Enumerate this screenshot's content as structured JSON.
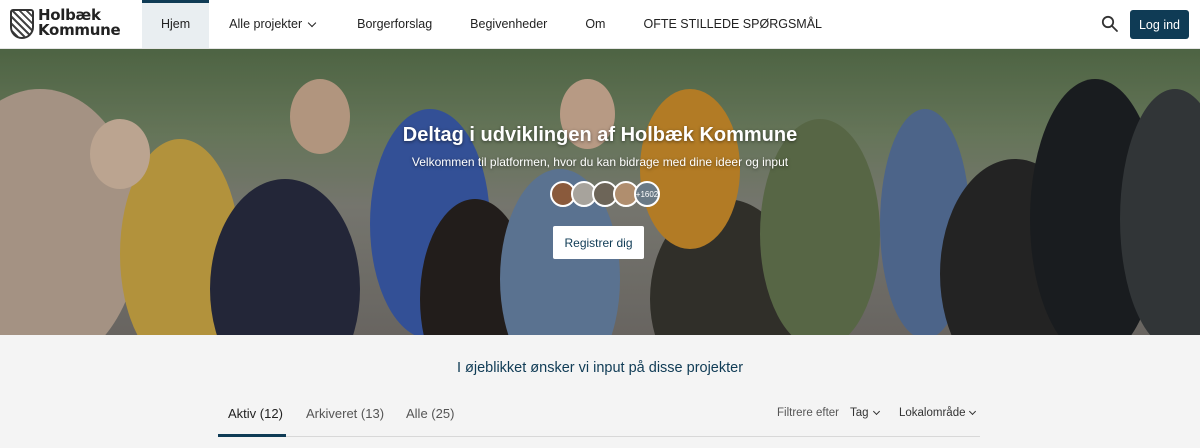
{
  "header": {
    "logo_line1": "Holbæk",
    "logo_line2": "Kommune",
    "nav": [
      {
        "label": "Hjem"
      },
      {
        "label": "Alle projekter"
      },
      {
        "label": "Borgerforslag"
      },
      {
        "label": "Begivenheder"
      },
      {
        "label": "Om"
      },
      {
        "label": "OFTE STILLEDE SPØRGSMÅL"
      }
    ],
    "login_label": "Log ind"
  },
  "hero": {
    "title": "Deltag i udviklingen af Holbæk Kommune",
    "subtitle": "Velkommen til platformen, hvor du kan bidrage med dine ideer og input",
    "participants_more": "+1602",
    "register_label": "Registrer dig"
  },
  "projects": {
    "title": "I øjeblikket ønsker vi input på disse projekter",
    "tabs": [
      {
        "label": "Aktiv (12)"
      },
      {
        "label": "Arkiveret (13)"
      },
      {
        "label": "Alle (25)"
      }
    ],
    "filter_label": "Filtrere efter",
    "filter_tag": "Tag",
    "filter_area": "Lokalområde"
  },
  "colors": {
    "primary": "#0f3b55",
    "active_nav_bg": "#e9eef1"
  }
}
